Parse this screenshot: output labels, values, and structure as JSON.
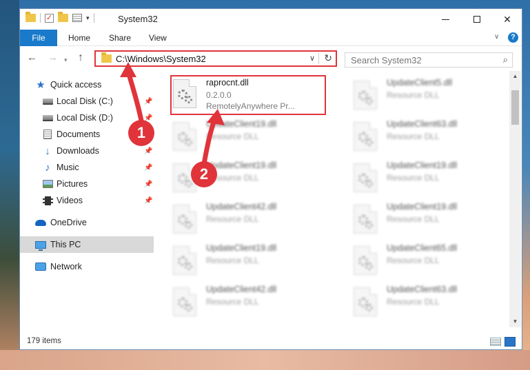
{
  "window": {
    "title": "System32",
    "controls": [
      "minimize",
      "maximize",
      "close"
    ]
  },
  "ribbon": {
    "file_tab": "File",
    "tabs": [
      "Home",
      "Share",
      "View"
    ]
  },
  "address_bar": {
    "path": "C:\\Windows\\System32"
  },
  "search": {
    "placeholder": "Search System32"
  },
  "sidebar": {
    "items": [
      {
        "label": "Quick access",
        "icon": "star-icon"
      },
      {
        "label": "Local Disk (C:)",
        "icon": "drive-icon",
        "pinned": true
      },
      {
        "label": "Local Disk (D:)",
        "icon": "drive-icon",
        "pinned": true
      },
      {
        "label": "Documents",
        "icon": "documents-icon",
        "pinned": true
      },
      {
        "label": "Downloads",
        "icon": "download-icon",
        "pinned": true
      },
      {
        "label": "Music",
        "icon": "music-icon",
        "pinned": true
      },
      {
        "label": "Pictures",
        "icon": "pictures-icon",
        "pinned": true
      },
      {
        "label": "Videos",
        "icon": "videos-icon",
        "pinned": true
      },
      {
        "label": "OneDrive",
        "icon": "cloud-icon"
      },
      {
        "label": "This PC",
        "icon": "computer-icon",
        "selected": true
      },
      {
        "label": "Network",
        "icon": "network-icon"
      }
    ]
  },
  "files": [
    {
      "name": "raprocnt.dll",
      "line2": "0.2.0.0",
      "line3": "RemotelyAnywhere Pr..."
    },
    {
      "name": "UpdateClient5.dll",
      "line2": "Resource DLL"
    },
    {
      "name": "UpdateClient19.dll",
      "line2": "Resource DLL"
    },
    {
      "name": "UpdateClient63.dll",
      "line2": "Resource DLL"
    },
    {
      "name": "UpdateClient19.dll",
      "line2": "Resource DLL"
    },
    {
      "name": "UpdateClient19.dll",
      "line2": "Resource DLL"
    },
    {
      "name": "UpdateClient42.dll",
      "line2": "Resource DLL"
    },
    {
      "name": "UpdateClient19.dll",
      "line2": "Resource DLL"
    },
    {
      "name": "UpdateClient19.dll",
      "line2": "Resource DLL"
    },
    {
      "name": "UpdateClient65.dll",
      "line2": "Resource DLL"
    },
    {
      "name": "UpdateClient42.dll",
      "line2": "Resource DLL"
    },
    {
      "name": "UpdateClient63.dll",
      "line2": "Resource DLL"
    }
  ],
  "status": {
    "item_count": "179 items"
  },
  "annotations": {
    "step1": "1",
    "step2": "2"
  },
  "colors": {
    "accent": "#1979ca",
    "highlight_red": "#e0343a",
    "selection": "#d9d9d9"
  }
}
